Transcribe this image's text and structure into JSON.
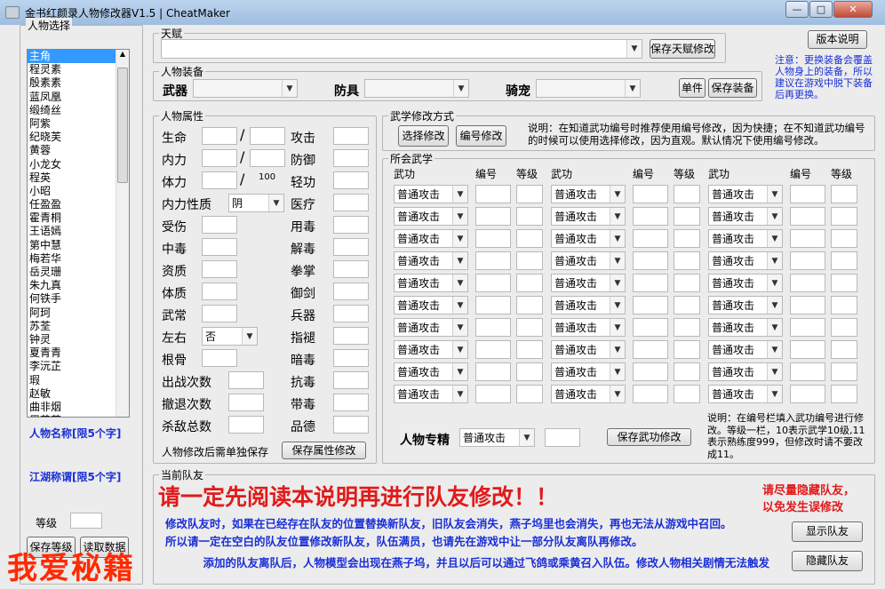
{
  "window": {
    "title": "金书红颜录人物修改器V1.5 | CheatMaker",
    "min": "—",
    "max": "□",
    "close": "✕"
  },
  "left": {
    "group_label": "人物选择",
    "characters": [
      "主角",
      "程灵素",
      "殷素素",
      "蓝凤凰",
      "缎绮丝",
      "阿紫",
      "纪晓芙",
      "黄蓉",
      "小龙女",
      "程英",
      "小昭",
      "任盈盈",
      "霍青桐",
      "王语嫣",
      "第中慧",
      "梅若华",
      "岳灵珊",
      "朱九真",
      "何铁手",
      "阿珂",
      "苏荃",
      "钟灵",
      "夏青青",
      "李沅芷",
      "瑕",
      "赵敏",
      "曲非烟",
      "周芷若"
    ],
    "name_hint": "人物名称[限5个字]",
    "title_hint": "江湖称谓[限5个字]",
    "level_label": "等级",
    "btn1": "保存等级",
    "btn2": "读取数据"
  },
  "talent": {
    "label": "天赋",
    "save": "保存天赋修改",
    "version": "版本说明",
    "note": "注意：更换装备会覆盖人物身上的装备，所以建议在游戏中脱下装备后再更换。"
  },
  "equip": {
    "label": "人物装备",
    "weapon": "武器",
    "armor": "防具",
    "mount": "骑宠",
    "single": "单件",
    "save": "保存装备"
  },
  "attrs": {
    "label": "人物属性",
    "hp": "生命",
    "mp": "内力",
    "stamina": "体力",
    "stamina_max": "100",
    "nature": "内力性质",
    "nature_val": "阴",
    "injury": "受伤",
    "poison": "中毒",
    "aptitude": "资质",
    "physique": "体质",
    "martial": "武常",
    "lr": "左右",
    "lr_val": "否",
    "bone": "根骨",
    "battles": "出战次数",
    "retreats": "撤退次数",
    "kills": "杀敌总数",
    "attack": "攻击",
    "defense": "防御",
    "agility": "轻功",
    "medical": "医疗",
    "usepoison": "用毒",
    "antidote": "解毒",
    "fist": "拳掌",
    "sword": "御剑",
    "weapons": "兵器",
    "finger": "指褪",
    "hidden": "暗毒",
    "resist": "抗毒",
    "carry": "带毒",
    "moral": "品德",
    "note": "人物修改后需单独保存",
    "save": "保存属性修改"
  },
  "mode": {
    "label": "武学修改方式",
    "select": "选择修改",
    "number": "编号修改",
    "note": "说明：在知道武功编号时推荐使用编号修改，因为快捷；在不知道武功编号的时候可以使用选择修改，因为直观。默认情况下使用编号修改。"
  },
  "skills": {
    "label": "所会武学",
    "col_skill": "武功",
    "col_num": "编号",
    "col_lv": "等级",
    "default": "普通攻击",
    "special_label": "人物专精",
    "special_val": "普通攻击",
    "save": "保存武功修改",
    "note": "说明：在编号栏填入武功编号进行修改。等级一栏，10表示武学10级,11表示熟练度999，但修改时请不要改成11。"
  },
  "team": {
    "label": "当前队友",
    "warning": "请一定先阅读本说明再进行队友修改！！",
    "side": "请尽量隐藏队友，以免发生误修改",
    "line1": "修改队友时，如果在已经存在队友的位置替换新队友，旧队友会消失，燕子坞里也会消失，再也无法从游戏中召回。",
    "line2": "所以请一定在空白的队友位置修改新队友，队伍满员，也请先在游戏中让一部分队友离队再修改。",
    "line3": "添加的队友离队后，人物模型会出现在燕子坞，并且以后可以通过飞鸽或乘黄召入队伍。修改人物相关剧情无法触发",
    "show": "显示队友",
    "hide": "隐藏队友"
  },
  "watermark": "我爱秘籍"
}
